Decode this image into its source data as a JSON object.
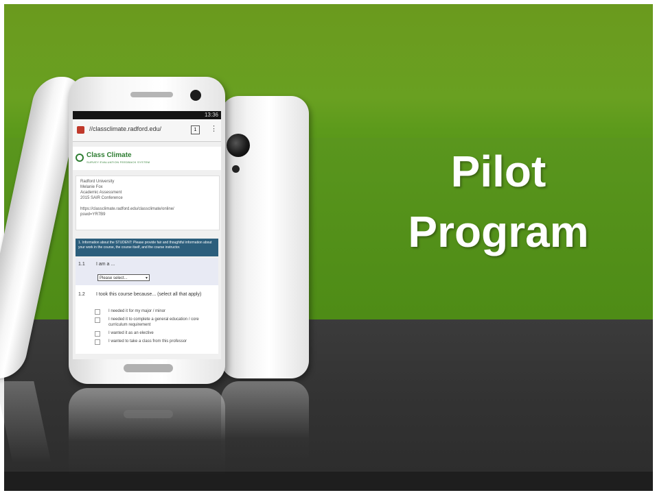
{
  "slide": {
    "title_line1": "Pilot",
    "title_line2": "Program",
    "colors": {
      "green": "#5c9a1b",
      "dark": "#333333",
      "bottom_bar": "#1e1e1e",
      "title": "#ffffff"
    }
  },
  "phone": {
    "status": "13:36",
    "url": "//classclimate.radford.edu/",
    "tabs_count": "1",
    "menu_icon": "vertical-ellipsis-icon",
    "logo_name": "Class Climate",
    "logo_tagline": "SURVEY EVALUATION FEEDBACK SYSTEM",
    "info_lines": [
      "Radford University",
      "Melanie Fox",
      "Academic Assessment",
      "2015 SAIR Conference",
      "",
      "https://classclimate.radford.edu/classclimate/online/",
      "pswd=YR7B9"
    ],
    "section_header": "1. Information about the STUDENT: Please provide fair and thoughtful information about your work in the course, the course itself, and the course instructor.",
    "questions": [
      {
        "num": "1.1",
        "text": "I am a ...",
        "select_value": "Please select..."
      },
      {
        "num": "1.2",
        "text": "I took this course because... (select all that apply)",
        "options": [
          "I needed it for my major / minor",
          "I needed it to complete a general education / core curriculum requirement",
          "I wanted it as an elective",
          "I wanted to take a class from this professor"
        ]
      }
    ]
  }
}
